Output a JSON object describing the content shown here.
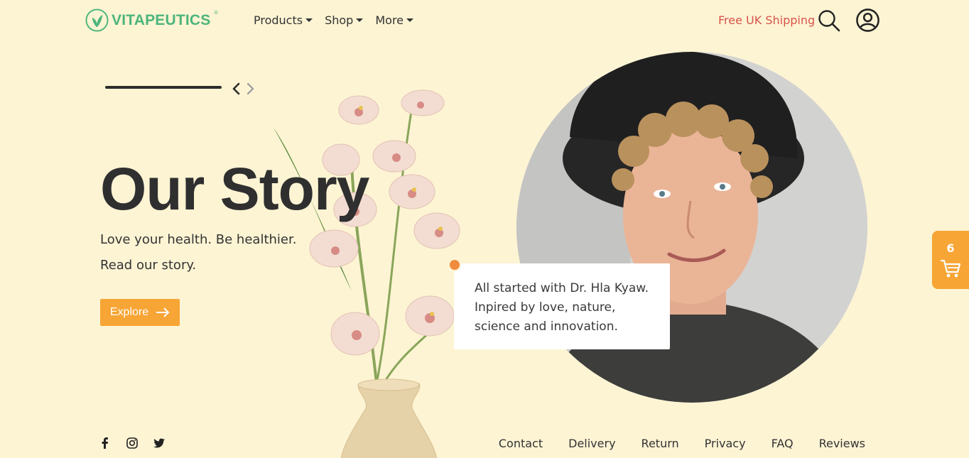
{
  "header": {
    "brand": "VITAPEUTICS",
    "brand_mark": "®",
    "nav": [
      {
        "label": "Products"
      },
      {
        "label": "Shop"
      },
      {
        "label": "More"
      }
    ],
    "shipping": "Free UK Shipping",
    "icons": {
      "search": "search-icon",
      "account": "user-circle-icon"
    }
  },
  "hero": {
    "title": "Our Story",
    "line1": "Love your health. Be healthier.",
    "line2": "Read our story.",
    "cta": "Explore"
  },
  "quote": {
    "lines": [
      "All started with Dr. Hla Kyaw.",
      "Inpired by love, nature,",
      "science and innovation."
    ]
  },
  "cart": {
    "count": "6"
  },
  "footer": {
    "social": [
      "facebook-icon",
      "instagram-icon",
      "twitter-icon"
    ],
    "links": [
      "Contact",
      "Delivery",
      "Return",
      "Privacy",
      "FAQ",
      "Reviews"
    ]
  },
  "colors": {
    "background": "#fdf4d4",
    "brand_green": "#4cb57c",
    "accent_orange": "#f7a535",
    "shipping_red": "#d9534a",
    "dot_orange": "#f08a3c"
  }
}
